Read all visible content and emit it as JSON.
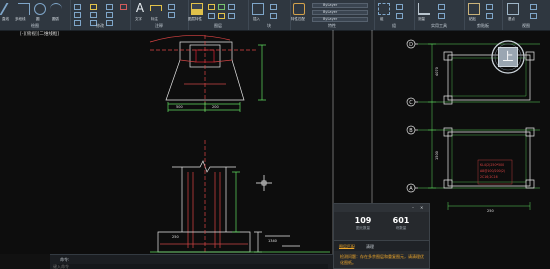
{
  "ribbon": {
    "groups": [
      {
        "id": "draw",
        "label": "绘图"
      },
      {
        "id": "modify",
        "label": "修改"
      },
      {
        "id": "annotation",
        "label": "注释"
      },
      {
        "id": "layers",
        "label": "图层"
      },
      {
        "id": "block",
        "label": "块"
      },
      {
        "id": "properties",
        "label": "特性"
      },
      {
        "id": "groups",
        "label": "组"
      },
      {
        "id": "utilities",
        "label": "实用工具"
      },
      {
        "id": "clipboard",
        "label": "剪贴板"
      },
      {
        "id": "view",
        "label": "视图"
      }
    ],
    "tools": {
      "line": "直线",
      "polyline": "多段线",
      "circle": "圆",
      "arc": "圆弧",
      "text": "文字",
      "dimension": "标注",
      "layer_props": "图层特性",
      "insert": "插入",
      "match_props": "特性匹配",
      "group": "组",
      "measure": "测量",
      "paste": "粘贴",
      "base": "基点"
    },
    "property_dropdowns": [
      "ByLayer",
      "ByLayer",
      "ByLayer"
    ]
  },
  "drawing": {
    "tab_label": "[-][俯视][二维线框]",
    "grid_labels": [
      "D",
      "C",
      "B",
      "A"
    ],
    "dims": {
      "d1": "500",
      "d2": "200",
      "d3": "250",
      "d4": "1340",
      "d5": "4070",
      "d6": "1500",
      "d7": "250"
    },
    "beam_text": [
      "KL4(2)250*500",
      "A8@100/200(2)",
      "2C16;2C16"
    ]
  },
  "navigation": {
    "viewcube_face": "上"
  },
  "panel": {
    "stats": [
      {
        "value": "109",
        "label": "图元数量"
      },
      {
        "value": "601",
        "label": "块数量"
      }
    ],
    "tabs": [
      "图层匹配",
      "清理"
    ],
    "message": "检测问题：存在多余图层和重复图元，请清理优化图纸。"
  },
  "command": {
    "prompt": "命令:",
    "placeholder": "键入命令"
  },
  "colors": {
    "ribbon_bg": "#2f3740",
    "canvas_bg": "#0d0d0d",
    "accent": "#f0a82a"
  }
}
